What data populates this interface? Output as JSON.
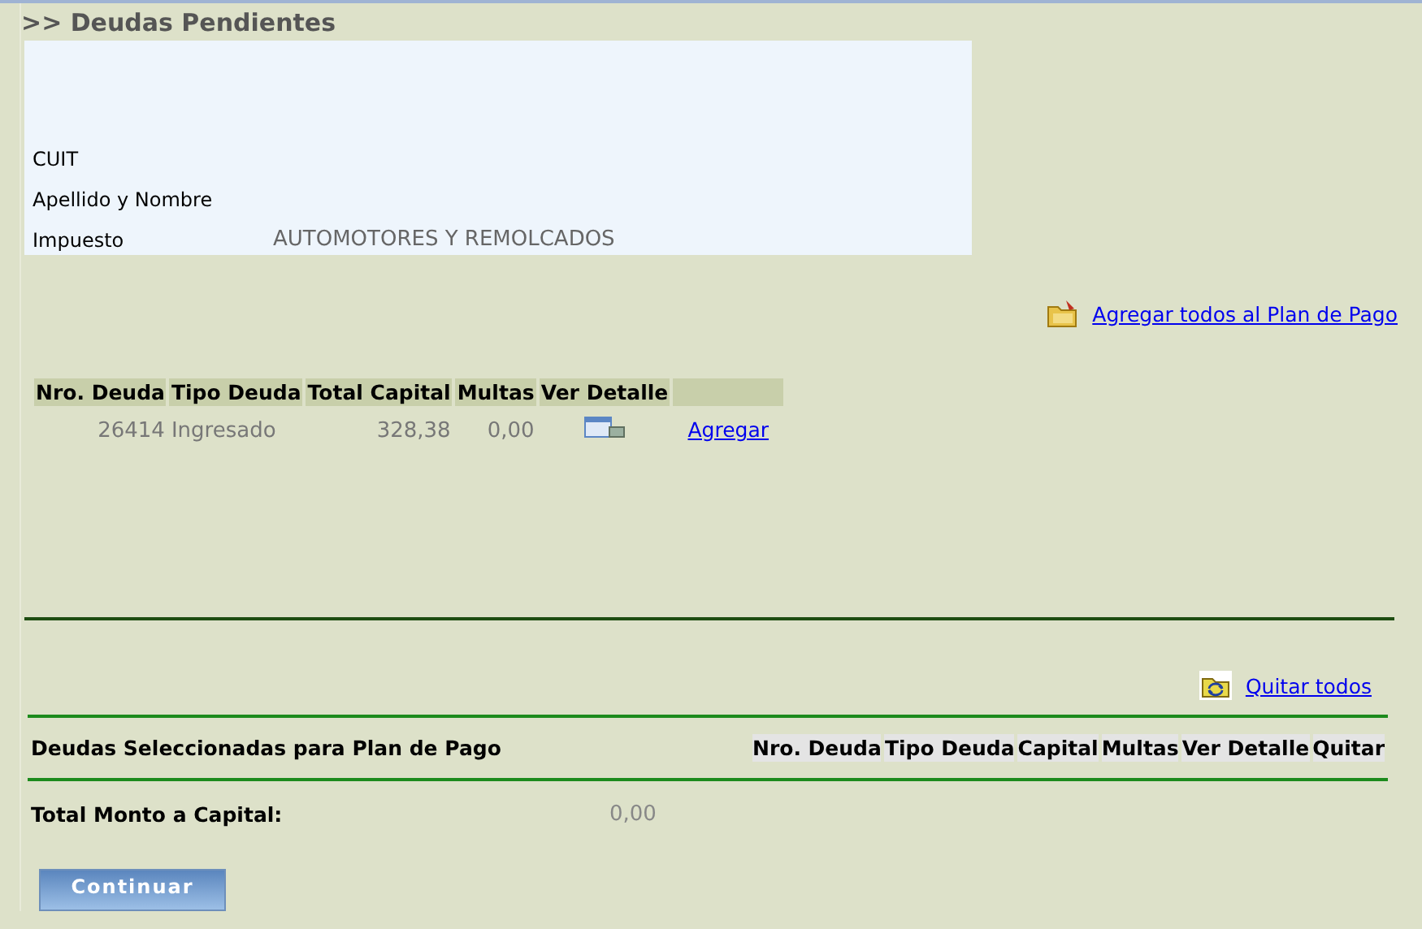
{
  "title": ">> Deudas Pendientes",
  "info": [
    {
      "label": "CUIT"
    },
    {
      "label": "Apellido y Nombre"
    },
    {
      "label": "Impuesto",
      "value": "AUTOMOTORES Y REMOLCADOS"
    }
  ],
  "add_all_link": "Agregar todos al Plan de Pago",
  "debts_table": {
    "columns": [
      "Nro. Deuda",
      "Tipo Deuda",
      "Total Capital",
      "Multas",
      "Ver Detalle"
    ],
    "rows": [
      {
        "number": "26414",
        "type": "Ingresado",
        "capital": "328,38",
        "fines": "0,00",
        "action": "Agregar"
      }
    ]
  },
  "remove_all_link": "Quitar todos",
  "selected_section": {
    "title": "Deudas Seleccionadas para Plan de Pago",
    "columns": [
      "Nro. Deuda",
      "Tipo Deuda",
      "Capital",
      "Multas",
      "Ver Detalle",
      "Quitar"
    ]
  },
  "total": {
    "label": "Total Monto a Capital:",
    "value": "0,00"
  },
  "continue_button": "Continuar"
}
